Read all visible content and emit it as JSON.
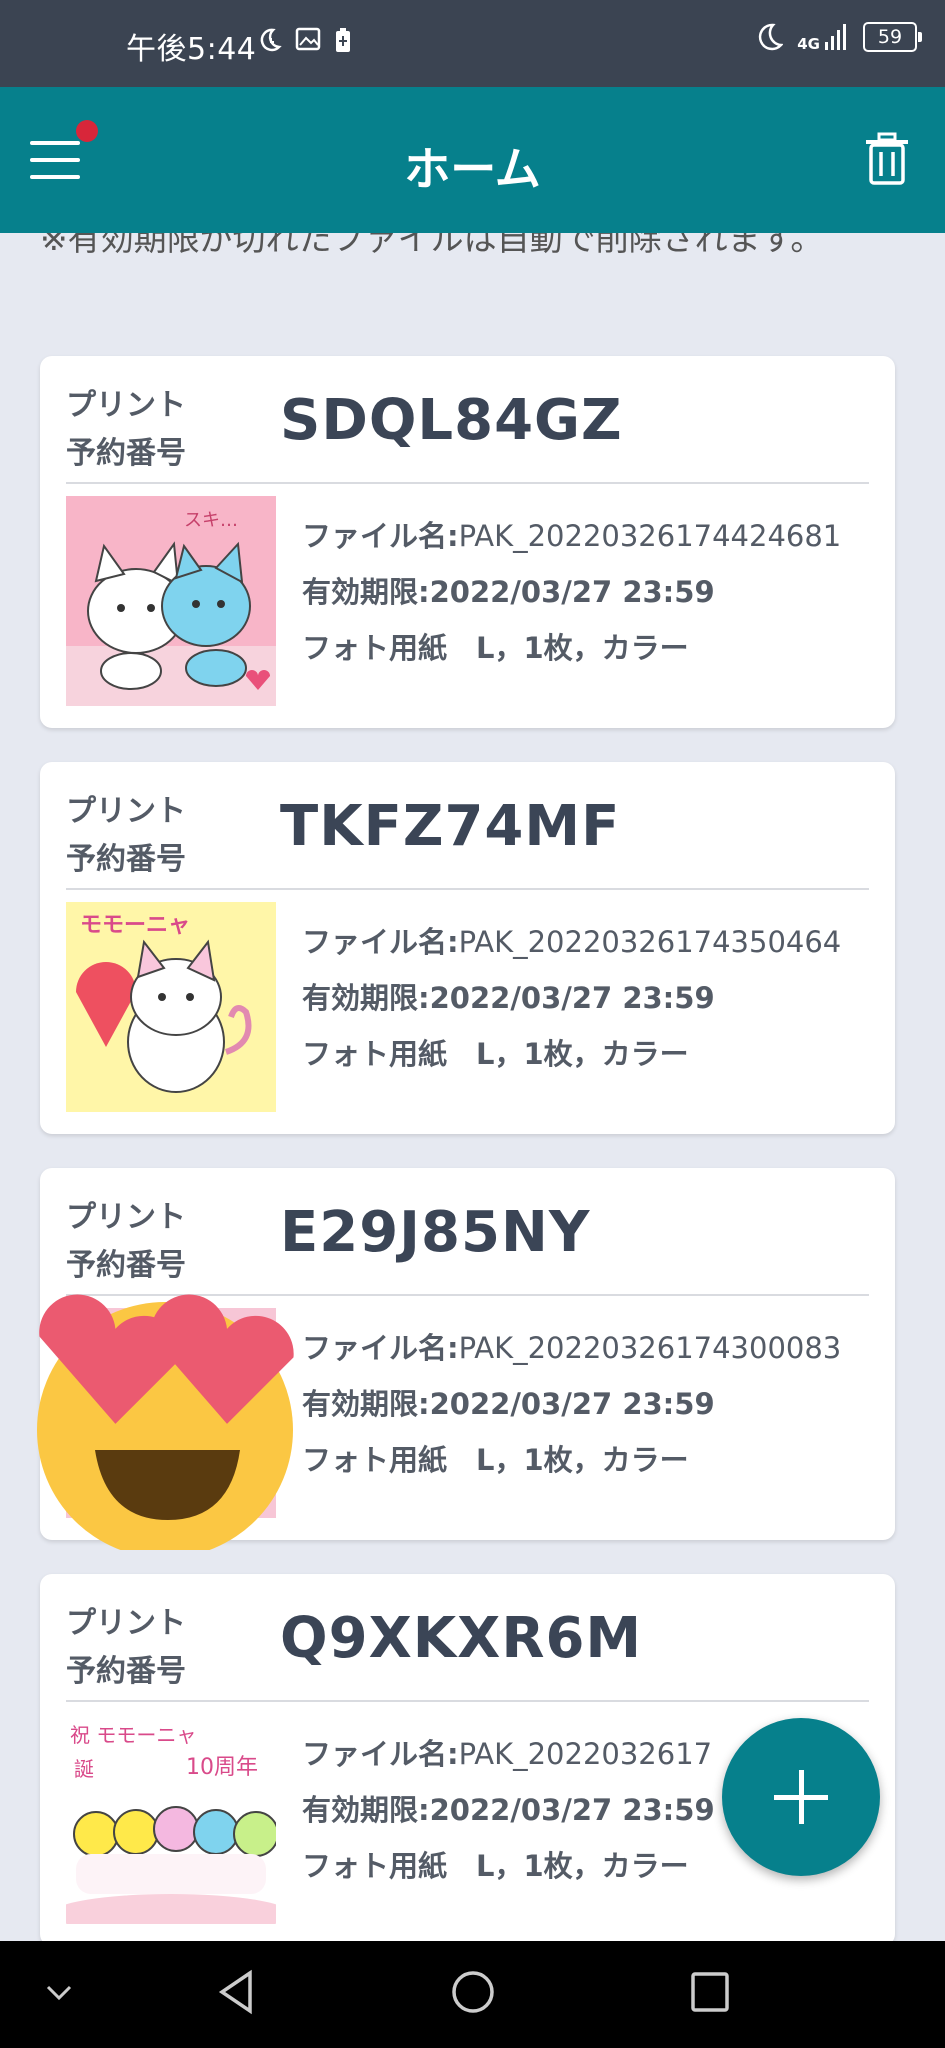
{
  "status_bar": {
    "time": "午後5:44",
    "left_icons": [
      "moon-clock-icon",
      "image-icon",
      "battery-saver-icon"
    ],
    "network": "4G",
    "battery": "59"
  },
  "app_bar": {
    "title": "ホーム",
    "menu_icon": "hamburger-icon",
    "action_icon": "trash-icon"
  },
  "notice": "※有効期限が切れたファイルは自動で削除されます。",
  "cards": [
    {
      "label_line1": "プリント",
      "label_line2": "予約番号",
      "code": "SDQL84GZ",
      "file_label": "ファイル名:",
      "file_name": "PAK_20220326174424681",
      "expiry_label": "有効期限:",
      "expiry": "2022/03/27 23:59",
      "spec": "フォト用紙　L，1枚，カラー"
    },
    {
      "label_line1": "プリント",
      "label_line2": "予約番号",
      "code": "TKFZ74MF",
      "file_label": "ファイル名:",
      "file_name": "PAK_20220326174350464",
      "expiry_label": "有効期限:",
      "expiry": "2022/03/27 23:59",
      "spec": "フォト用紙　L，1枚，カラー"
    },
    {
      "label_line1": "プリント",
      "label_line2": "予約番号",
      "code": "E29J85NY",
      "file_label": "ファイル名:",
      "file_name": "PAK_20220326174300083",
      "expiry_label": "有効期限:",
      "expiry": "2022/03/27 23:59",
      "spec": "フォト用紙　L，1枚，カラー"
    },
    {
      "label_line1": "プリント",
      "label_line2": "予約番号",
      "code": "Q9XKXR6M",
      "file_label": "ファイル名:",
      "file_name": "PAK_2022032617",
      "expiry_label": "有効期限:",
      "expiry": "2022/03/27 23:59",
      "spec": "フォト用紙　L，1枚，カラー"
    }
  ],
  "thumb_text": {
    "t1": "スキ…",
    "t2": "モモーニャ",
    "t4a": "祝 モモーニャ",
    "t4b": "誕",
    "t4c": "10周年"
  },
  "fab_icon": "plus-icon",
  "nav": {
    "items": [
      "chevron-down-icon",
      "back-icon",
      "home-icon",
      "recents-icon"
    ]
  }
}
